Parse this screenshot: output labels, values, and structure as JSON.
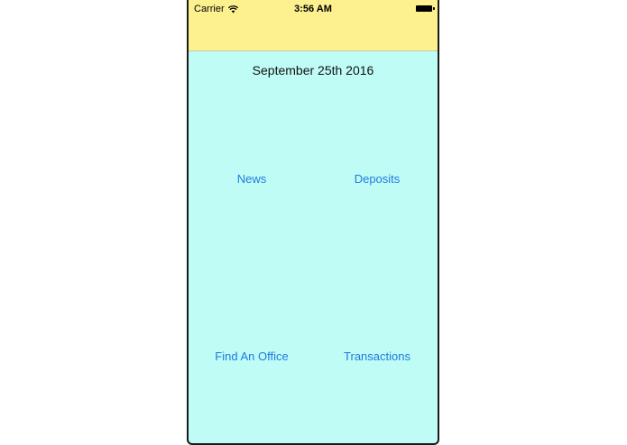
{
  "status_bar": {
    "carrier": "Carrier",
    "time": "3:56 AM",
    "wifi_icon": "wifi-icon",
    "battery_icon": "battery-icon"
  },
  "main": {
    "date": "September 25th 2016",
    "buttons": {
      "news": "News",
      "deposits": "Deposits",
      "find_office": "Find An Office",
      "transactions": "Transactions"
    }
  },
  "colors": {
    "header": "#fdf08f",
    "background": "#bffcf6",
    "link": "#1f7ae0"
  }
}
